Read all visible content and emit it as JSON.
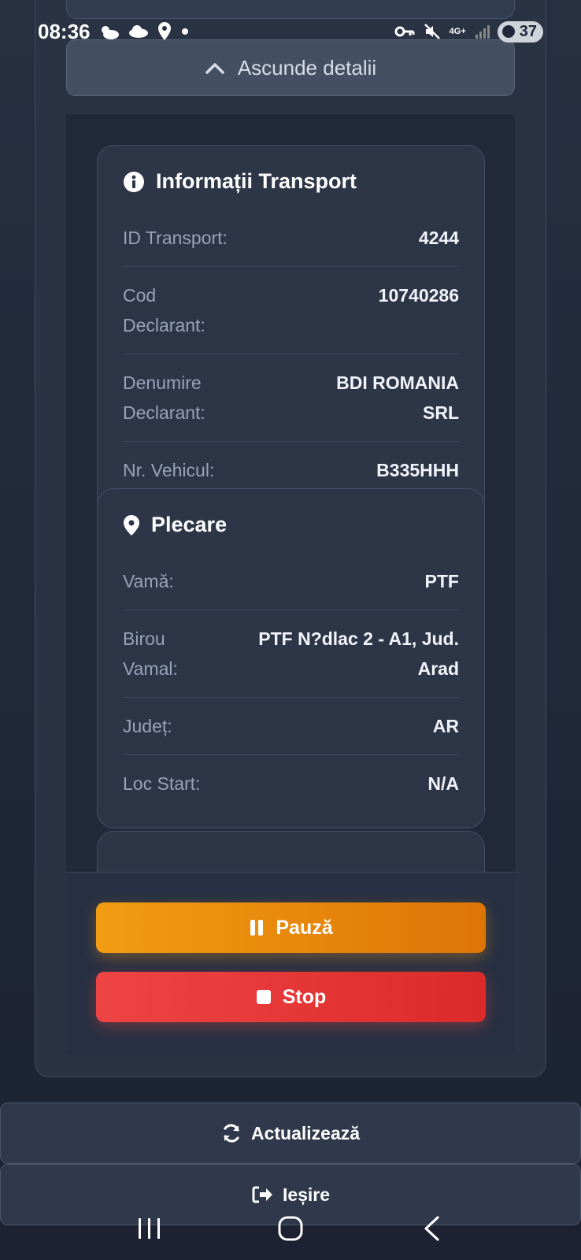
{
  "status_bar": {
    "time": "08:36",
    "network": "4G+",
    "battery": "37"
  },
  "toggle_details_label": "Ascunde detalii",
  "transport_card": {
    "title": "Informații Transport",
    "rows": [
      {
        "label": "ID Transport:",
        "value": "4244"
      },
      {
        "label": "Cod Declarant:",
        "value": "10740286"
      },
      {
        "label": "Denumire Declarant:",
        "value": "BDI ROMANIA SRL"
      },
      {
        "label": "Nr. Vehicul:",
        "value": "B335HHH"
      }
    ]
  },
  "departure_card": {
    "title": "Plecare",
    "rows": [
      {
        "label": "Vamă:",
        "value": "PTF"
      },
      {
        "label": "Birou Vamal:",
        "value": "PTF N?dlac 2 - A1, Jud. Arad"
      },
      {
        "label": "Județ:",
        "value": "AR"
      },
      {
        "label": "Loc Start:",
        "value": "N/A"
      }
    ]
  },
  "actions": {
    "pause_label": "Pauză",
    "stop_label": "Stop"
  },
  "update_label": "Actualizează",
  "exit_label": "Ieșire",
  "colors": {
    "pause": "#f39c12",
    "stop": "#ef4444",
    "background": "#1e2434"
  }
}
